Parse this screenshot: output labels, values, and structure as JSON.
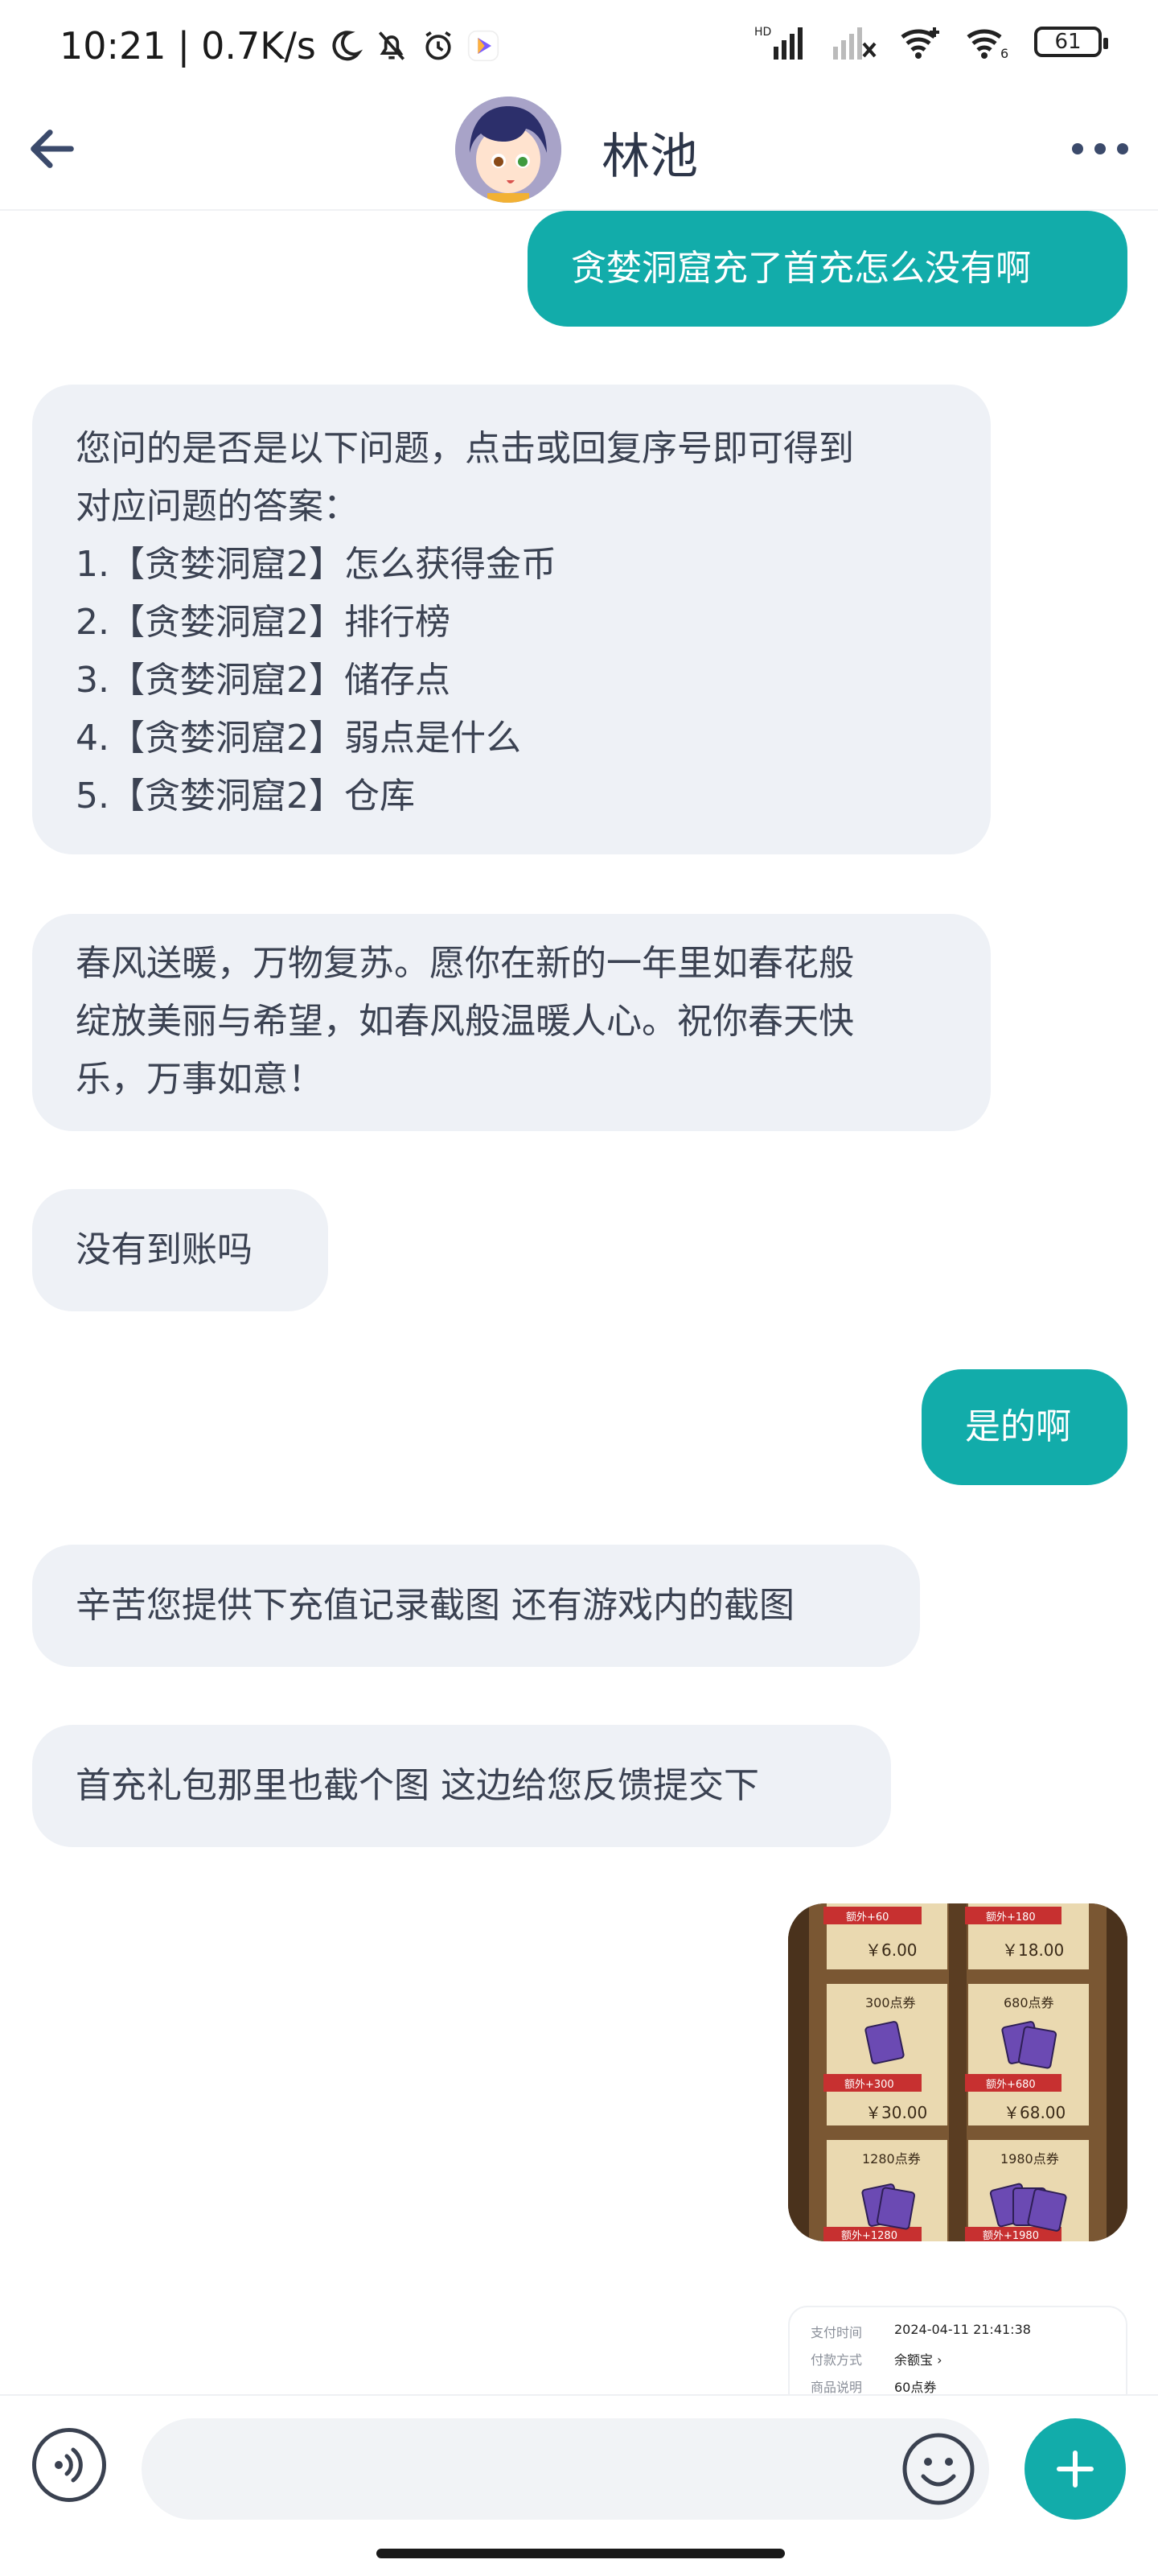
{
  "status_bar": {
    "time": "10:21",
    "speed": "0.7K/s",
    "battery": "61"
  },
  "header": {
    "title": "林池"
  },
  "messages": [
    {
      "side": "out",
      "lines": [
        "贪婪洞窟充了首充怎么没有啊"
      ]
    },
    {
      "side": "in",
      "lines": [
        "您问的是否是以下问题，点击或回复序号即可得到",
        "对应问题的答案：",
        "1.【贪婪洞窟2】怎么获得金币",
        "2.【贪婪洞窟2】排行榜",
        "3.【贪婪洞窟2】储存点",
        "4.【贪婪洞窟2】弱点是什么",
        "5.【贪婪洞窟2】仓库"
      ]
    },
    {
      "side": "in",
      "lines": [
        "春风送暖，万物复苏。愿你在新的一年里如春花般",
        "绽放美丽与希望，如春风般温暖人心。祝你春天快",
        "乐，万事如意！"
      ]
    },
    {
      "side": "in",
      "lines": [
        "没有到账吗"
      ]
    },
    {
      "side": "out",
      "lines": [
        "是的啊"
      ]
    },
    {
      "side": "in",
      "lines": [
        "辛苦您提供下充值记录截图 还有游戏内的截图"
      ]
    },
    {
      "side": "in",
      "lines": [
        "首充礼包那里也截个图 这边给您反馈提交下"
      ]
    }
  ],
  "store_image": {
    "prices": [
      "￥6.00",
      "￥18.00",
      "￥30.00",
      "￥68.00"
    ],
    "card_titles": [
      "300点券",
      "680点券",
      "1280点券",
      "1980点券"
    ],
    "bonus_labels": [
      "额外+60",
      "额外+180",
      "额外+300",
      "额外+680",
      "额外+1280",
      "额外+1980"
    ]
  },
  "receipt_image": {
    "rows": [
      {
        "label": "支付时间",
        "value": "2024-04-11 21:41:38"
      },
      {
        "label": "付款方式",
        "value": "余额宝 ›"
      },
      {
        "label": "商品说明",
        "value": "60点券"
      }
    ]
  }
}
